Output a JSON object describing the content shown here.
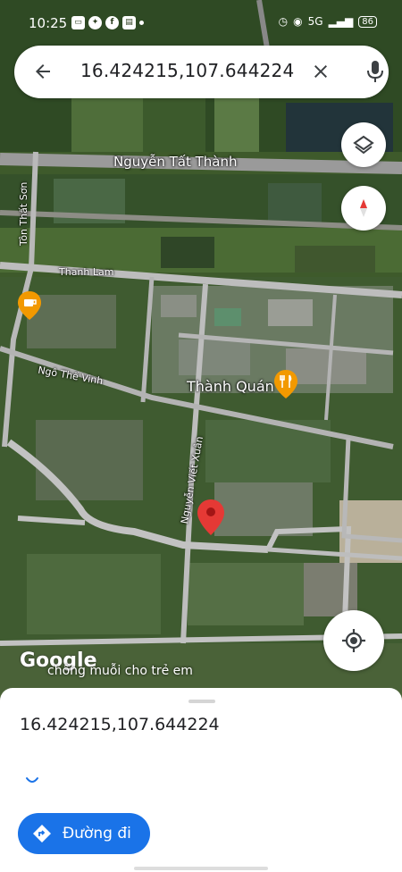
{
  "status_bar": {
    "time": "10:25",
    "app_icons": [
      "chat-icon",
      "messenger-icon",
      "facebook-icon",
      "news-icon"
    ],
    "network": "5G",
    "battery": "86"
  },
  "search": {
    "query": "16.424215,107.644224"
  },
  "map": {
    "street_labels": {
      "nguyen_tat_thanh": "Nguyễn Tất Thành",
      "ton_that_son": "Tôn Thất Sơn",
      "thanh_lam": "Thanh Lam",
      "ngo_the_vinh": "Ngô Thế Vinh",
      "nguyen_viet_xuan": "Nguyễn Viết Xuân"
    },
    "place_label": "Thành Quán",
    "logo": "Google",
    "promo_text": "chống muỗi cho trẻ em",
    "colors": {
      "pin": "#e53935",
      "poi": "#f29900"
    }
  },
  "bottom_sheet": {
    "coordinates": "16.424215,107.644224",
    "directions_label": "Đường đi",
    "accent": "#1a73e8"
  }
}
